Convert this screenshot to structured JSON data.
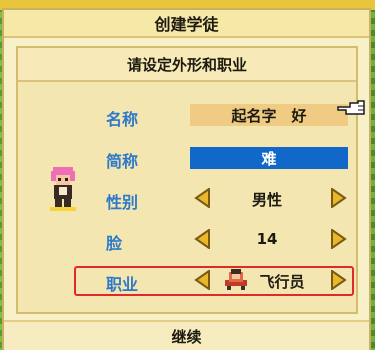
{
  "dialog": {
    "title": "创建学徒",
    "subtitle": "请设定外形和职业",
    "confirm_label": "继续"
  },
  "fields": {
    "name_label": "名称",
    "name_value": "起名字　好",
    "abbr_label": "简称",
    "abbr_value": "难",
    "gender_label": "性别",
    "gender_value": "男性",
    "face_label": "脸",
    "face_value": "14",
    "job_label": "职业",
    "job_value": "飞行员"
  },
  "colors": {
    "label_blue": "#2e79c9",
    "highlight_blue": "#1268c9",
    "arrow_gold": "#e8b72c",
    "annotation_red": "#e02a2a"
  },
  "icons": {
    "arrow_left": "triangle-left-icon",
    "arrow_right": "triangle-right-icon",
    "cursor": "pointing-hand-icon",
    "avatar": "pink-hair-apprentice-sprite",
    "job": "pilot-sprite-icon"
  }
}
